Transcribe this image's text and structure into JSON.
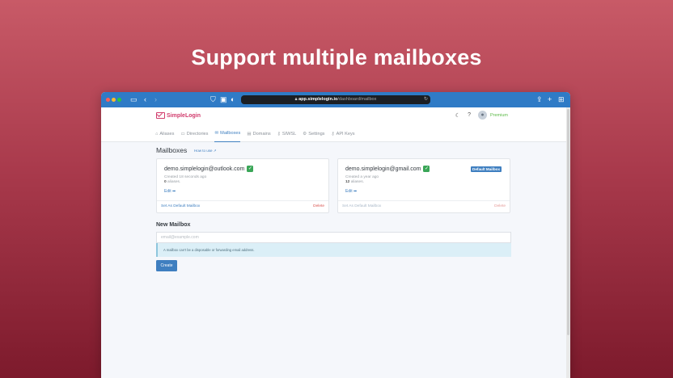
{
  "headline": "Support multiple mailboxes",
  "browser": {
    "url_host": "app.simplelogin.io",
    "url_path": "/dashboard/mailbox"
  },
  "app": {
    "logo_text": "SimpleLogin",
    "premium_label": "Premium"
  },
  "tabs": [
    {
      "label": "Aliases",
      "icon": "home-icon"
    },
    {
      "label": "Directories",
      "icon": "folder-icon"
    },
    {
      "label": "Mailboxes",
      "icon": "mail-icon",
      "active": true
    },
    {
      "label": "Domains",
      "icon": "server-icon"
    },
    {
      "label": "SIWSL",
      "icon": "key-icon"
    },
    {
      "label": "Settings",
      "icon": "gear-icon"
    },
    {
      "label": "API Keys",
      "icon": "key-icon"
    }
  ],
  "page": {
    "title": "Mailboxes",
    "how_to_use": "How to use ↗"
  },
  "mailboxes": [
    {
      "email": "demo.simplelogin@outlook.com",
      "created": "Created 18 seconds ago",
      "aliases_count": "0",
      "aliases_suffix": "aliases.",
      "edit": "Edit ➡",
      "set_default": "Set As Default Mailbox",
      "delete": "Delete"
    },
    {
      "email": "demo.simplelogin@gmail.com",
      "badge": "Default Mailbox",
      "created": "Created a year ago",
      "aliases_count": "12",
      "aliases_suffix": "aliases.",
      "edit": "Edit ➡",
      "set_default": "Set As Default Mailbox",
      "delete": "Delete"
    }
  ],
  "new_mailbox": {
    "title": "New Mailbox",
    "placeholder": "email@example.com",
    "alert": "A mailbox can't be a disposable or forwarding email address.",
    "create": "Create"
  },
  "colors": {
    "brand": "#d13b6c",
    "accent": "#3f7fc0",
    "danger": "#d9534f",
    "success": "#3aa657"
  }
}
